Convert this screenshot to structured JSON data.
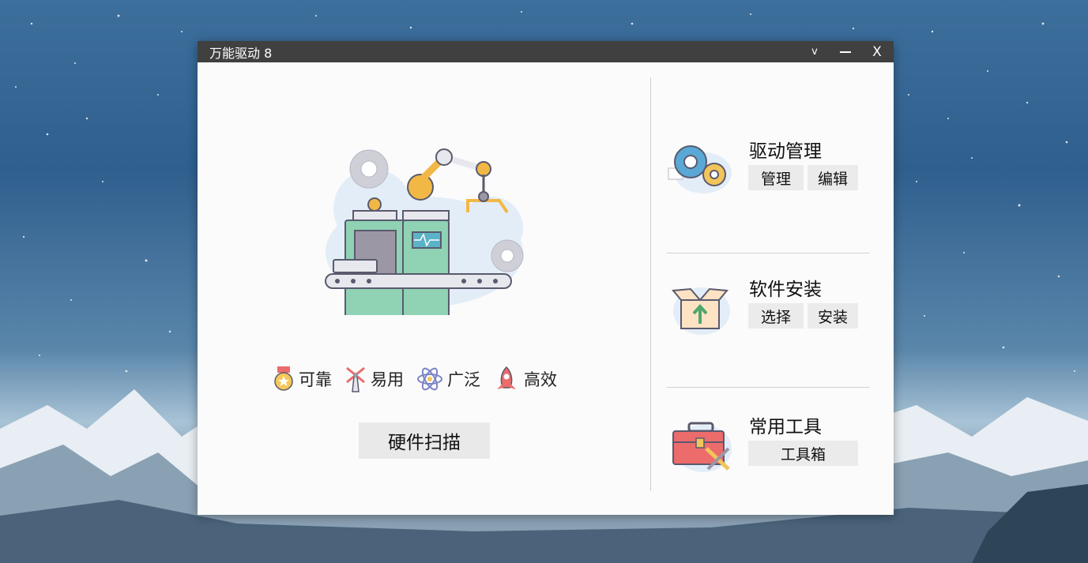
{
  "window": {
    "title": "万能驱动 8"
  },
  "titlebar_buttons": {
    "menu": "v",
    "minimize": "—",
    "close": "X"
  },
  "features": [
    {
      "label": "可靠",
      "icon": "medal-icon"
    },
    {
      "label": "易用",
      "icon": "windmill-icon"
    },
    {
      "label": "广泛",
      "icon": "atom-icon"
    },
    {
      "label": "高效",
      "icon": "rocket-icon"
    }
  ],
  "scan_button": "硬件扫描",
  "sections": [
    {
      "title": "驱动管理",
      "icon": "gears-icon",
      "buttons": [
        "管理",
        "编辑"
      ]
    },
    {
      "title": "软件安装",
      "icon": "package-upload-icon",
      "buttons": [
        "选择",
        "安装"
      ]
    },
    {
      "title": "常用工具",
      "icon": "toolbox-icon",
      "buttons": [
        "工具箱"
      ]
    }
  ],
  "colors": {
    "titlebar": "#404040",
    "button_bg": "#e9e9e9",
    "window_bg": "#fbfbfb"
  }
}
